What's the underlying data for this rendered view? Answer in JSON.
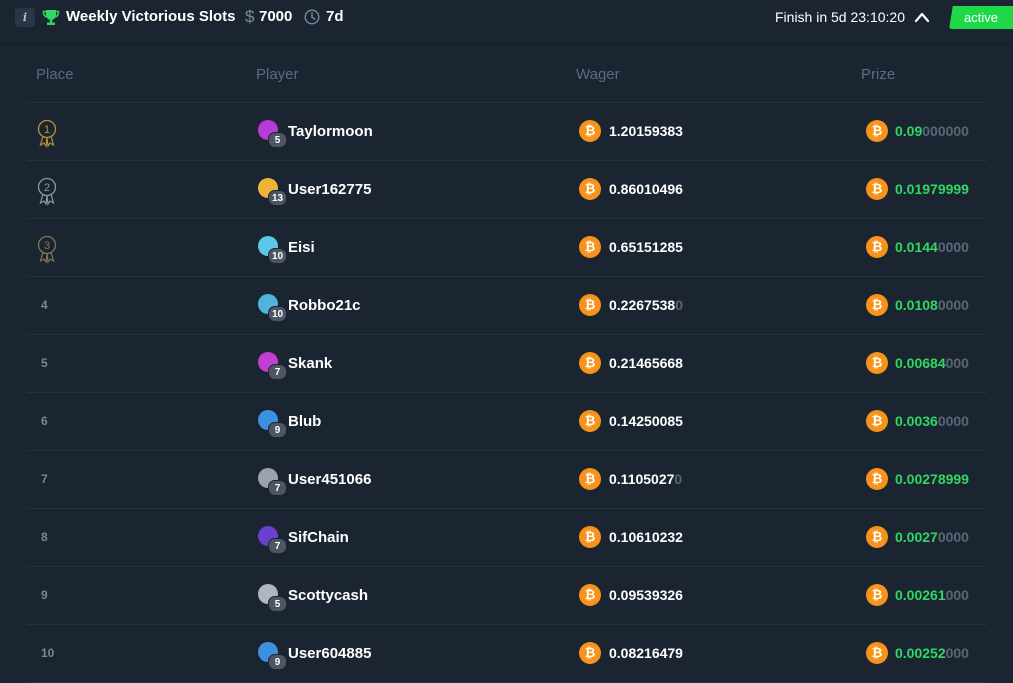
{
  "header": {
    "info_icon": "i",
    "trophy_icon": "trophy-icon",
    "title": "Weekly Victorious Slots",
    "currency_symbol": "$",
    "amount": "7000",
    "clock_icon": "clock-icon",
    "duration": "7d",
    "finish_text": "Finish in 5d 23:10:20",
    "collapse_icon": "chevron-up-icon",
    "status": "active"
  },
  "colors": {
    "background": "#1b2532",
    "accent_green": "#1fd84a",
    "bitcoin_orange": "#f7931a",
    "prize_green": "#2fd862",
    "medal_gold": "#b8913a",
    "medal_silver": "#8e98a4",
    "medal_bronze": "#7f7750"
  },
  "table": {
    "columns": [
      "Place",
      "Player",
      "Wager",
      "Prize"
    ],
    "rows": [
      {
        "place": "1",
        "medal": "gold",
        "player": "Taylormoon",
        "level": "5",
        "avatar_color": "#b73bd6",
        "wager_main": "1.20159383",
        "wager_dim": "",
        "prize_main": "0.09",
        "prize_dim": "000000"
      },
      {
        "place": "2",
        "medal": "silver",
        "player": "User162775",
        "level": "13",
        "avatar_color": "#f0b33a",
        "wager_main": "0.86010496",
        "wager_dim": "",
        "prize_main": "0.01979999",
        "prize_dim": ""
      },
      {
        "place": "3",
        "medal": "bronze",
        "player": "Eisi",
        "level": "10",
        "avatar_color": "#5cc8e6",
        "wager_main": "0.65151285",
        "wager_dim": "",
        "prize_main": "0.0144",
        "prize_dim": "0000"
      },
      {
        "place": "4",
        "medal": "",
        "player": "Robbo21c",
        "level": "10",
        "avatar_color": "#4fb4d8",
        "wager_main": "0.2267538",
        "wager_dim": "0",
        "prize_main": "0.0108",
        "prize_dim": "0000"
      },
      {
        "place": "5",
        "medal": "",
        "player": "Skank",
        "level": "7",
        "avatar_color": "#c23fd0",
        "wager_main": "0.21465668",
        "wager_dim": "",
        "prize_main": "0.00684",
        "prize_dim": "000"
      },
      {
        "place": "6",
        "medal": "",
        "player": "Blub",
        "level": "9",
        "avatar_color": "#3d8fe0",
        "wager_main": "0.14250085",
        "wager_dim": "",
        "prize_main": "0.0036",
        "prize_dim": "0000"
      },
      {
        "place": "7",
        "medal": "",
        "player": "User451066",
        "level": "7",
        "avatar_color": "#9aa3ad",
        "wager_main": "0.1105027",
        "wager_dim": "0",
        "prize_main": "0.00278999",
        "prize_dim": ""
      },
      {
        "place": "8",
        "medal": "",
        "player": "SifChain",
        "level": "7",
        "avatar_color": "#6a3fd0",
        "wager_main": "0.10610232",
        "wager_dim": "",
        "prize_main": "0.0027",
        "prize_dim": "0000"
      },
      {
        "place": "9",
        "medal": "",
        "player": "Scottycash",
        "level": "5",
        "avatar_color": "#b0b6be",
        "wager_main": "0.09539326",
        "wager_dim": "",
        "prize_main": "0.00261",
        "prize_dim": "000"
      },
      {
        "place": "10",
        "medal": "",
        "player": "User604885",
        "level": "9",
        "avatar_color": "#3d8fe0",
        "wager_main": "0.08216479",
        "wager_dim": "",
        "prize_main": "0.00252",
        "prize_dim": "000"
      }
    ]
  }
}
